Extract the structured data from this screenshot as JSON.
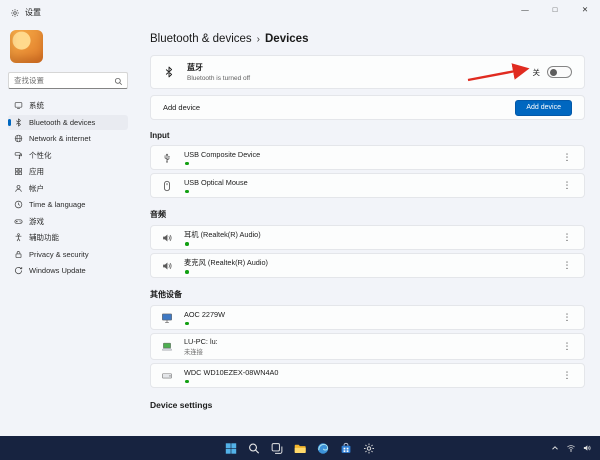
{
  "window": {
    "app_title": "设置",
    "controls": {
      "minimize": "—",
      "maximize": "□",
      "close": "✕"
    }
  },
  "glyphs": {
    "menu_dots": "⋮"
  },
  "colors": {
    "accent": "#0067c0",
    "status_green": "#12a012",
    "arrow_red": "#e02b20",
    "taskbar": "#172340"
  },
  "sidebar": {
    "search": {
      "placeholder": "查找设置"
    },
    "items": [
      {
        "key": "system",
        "label": "系统",
        "icon": "system",
        "selected": false
      },
      {
        "key": "bluetooth-devices",
        "label": "Bluetooth & devices",
        "icon": "bluetooth",
        "selected": true
      },
      {
        "key": "network-internet",
        "label": "Network & internet",
        "icon": "network",
        "selected": false
      },
      {
        "key": "personalization",
        "label": "个性化",
        "icon": "personalization",
        "selected": false
      },
      {
        "key": "apps",
        "label": "应用",
        "icon": "apps",
        "selected": false
      },
      {
        "key": "accounts",
        "label": "帐户",
        "icon": "accounts",
        "selected": false
      },
      {
        "key": "time-language",
        "label": "Time & language",
        "icon": "time",
        "selected": false
      },
      {
        "key": "gaming",
        "label": "游戏",
        "icon": "gaming",
        "selected": false
      },
      {
        "key": "accessibility",
        "label": "辅助功能",
        "icon": "accessibility",
        "selected": false
      },
      {
        "key": "privacy-security",
        "label": "Privacy & security",
        "icon": "privacy",
        "selected": false
      },
      {
        "key": "windows-update",
        "label": "Windows Update",
        "icon": "update",
        "selected": false
      }
    ]
  },
  "breadcrumb": {
    "parent": "Bluetooth & devices",
    "separator": "›",
    "current": "Devices"
  },
  "bluetooth": {
    "title": "蓝牙",
    "subtitle": "Bluetooth is turned off",
    "toggle_label": "关",
    "toggle_state": "off"
  },
  "add_device": {
    "row_label": "Add device",
    "button_label": "Add device"
  },
  "device_sections": [
    {
      "title": "Input",
      "devices": [
        {
          "key": "usb-composite-device",
          "name": "USB Composite Device",
          "icon": "usb",
          "status_dot": true
        },
        {
          "key": "usb-optical-mouse",
          "name": "USB Optical Mouse",
          "icon": "mouse",
          "status_dot": true
        }
      ]
    },
    {
      "title": "音频",
      "devices": [
        {
          "key": "headphones",
          "name": "耳机 (Realtek(R) Audio)",
          "icon": "audio",
          "status_dot": true
        },
        {
          "key": "microphone",
          "name": "麦克风 (Realtek(R) Audio)",
          "icon": "audio",
          "status_dot": true
        }
      ]
    },
    {
      "title": "其他设备",
      "devices": [
        {
          "key": "aoc-2279w",
          "name": "AOC 2279W",
          "icon": "monitor",
          "status_dot": true
        },
        {
          "key": "lu-pc",
          "name": "LU-PC: lu:",
          "subtitle": "未连接",
          "icon": "laptop",
          "status_dot": false
        },
        {
          "key": "wdc-drive",
          "name": "WDC WD10EZEX-08WN4A0",
          "icon": "drive",
          "status_dot": true
        }
      ]
    }
  ],
  "footer_heading": "Device settings",
  "taskbar": {
    "icons": [
      "start",
      "search",
      "task-view",
      "file-explorer",
      "edge",
      "store",
      "settings"
    ],
    "tray_icons": [
      "chevron-up",
      "network",
      "volume"
    ]
  }
}
